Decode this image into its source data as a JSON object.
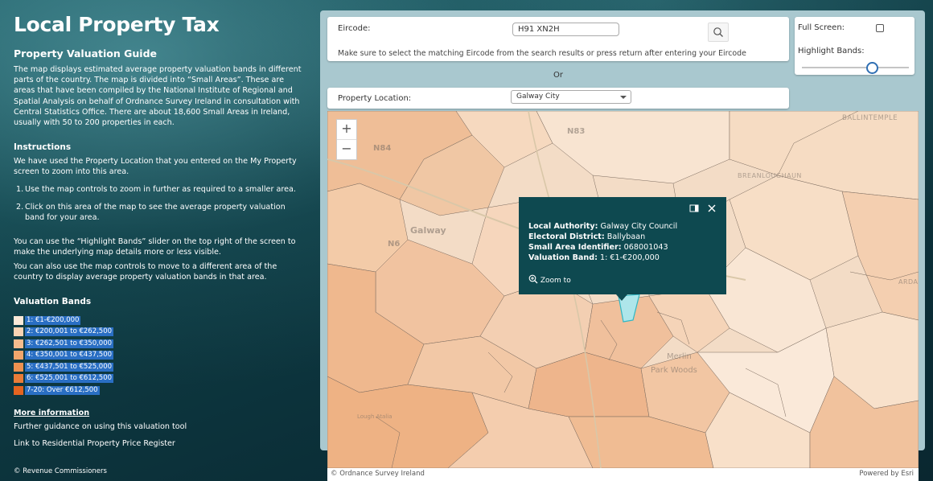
{
  "sidebar": {
    "title": "Local Property Tax",
    "subtitle": "Property Valuation Guide",
    "intro": "The map displays estimated average property valuation bands in different parts of the country. The map is divided into “Small Areas”. These are areas that have been compiled by the National Institute of Regional and Spatial Analysis on behalf of Ordnance Survey Ireland in consultation with Central Statistics Office. There are about 18,600 Small Areas in Ireland, usually with 50 to 200 properties in each.",
    "instructions_heading": "Instructions",
    "instructions_intro": "We have used the Property Location that you entered on the My Property screen to zoom into this area.",
    "steps": [
      {
        "num": "1.",
        "text": "Use the map controls to zoom in further as required to a smaller area."
      },
      {
        "num": "2.",
        "text": "Click on this area of the map to see the average property valuation band for your area."
      }
    ],
    "highlight_note": "You can use the “Highlight Bands” slider on the top right of the screen to make the underlying map details more or less visible.",
    "controls_note": "You can also use the map controls to move to a different area of the country to display average property valuation bands in that area.",
    "bands_heading": "Valuation Bands",
    "bands": [
      {
        "label": "1: €1-€200,000",
        "color": "#fbe9d8"
      },
      {
        "label": "2: €200,001 to €262,500",
        "color": "#f8d3b3"
      },
      {
        "label": "3: €262,501 to €350,000",
        "color": "#f5bc8e"
      },
      {
        "label": "4: €350,001 to €437,500",
        "color": "#f1a66c"
      },
      {
        "label": "5: €437,501 to €525,000",
        "color": "#ee9150"
      },
      {
        "label": "6: €525,001 to €612,500",
        "color": "#ea7c38"
      },
      {
        "label": "7-20: Over €612,500",
        "color": "#e46420"
      }
    ],
    "more_info": "More information",
    "guidance_link": "Further guidance on using this valuation tool",
    "register_link": "Link to Residential Property Price Register",
    "copyright": "© Revenue Commissioners"
  },
  "search": {
    "eircode_label": "Eircode:",
    "eircode_value": "H91 XN2H",
    "hint": "Make sure to select the matching Eircode from the search results or press return after entering your Eircode",
    "or": "Or",
    "location_label": "Property Location:",
    "location_value": "Galway City"
  },
  "options": {
    "fullscreen_label": "Full Screen:",
    "highlight_label": "Highlight Bands:",
    "highlight_value": 0.65
  },
  "map": {
    "zoom_in": "+",
    "zoom_out": "−",
    "labels": {
      "ballintemple": "BALLINTEMPLE",
      "breanloughaun": "BREANLOUGHAUN",
      "galway": "Galway",
      "n84": "N84",
      "n83": "N83",
      "n6": "N6",
      "arda": "ARDA",
      "merlin": "Merlin",
      "park_woods": "Park Woods",
      "lough_atalia": "Lough Atalia"
    },
    "attribution": "© Ordnance Survey Ireland",
    "powered_by": "Powered by Esri"
  },
  "popup": {
    "authority_label": "Local Authority:",
    "authority_value": "Galway City Council",
    "district_label": "Electoral District:",
    "district_value": "Ballybaan",
    "area_label": "Small Area Identifier:",
    "area_value": "068001043",
    "band_label": "Valuation Band:",
    "band_value": "1: €1-€200,000",
    "zoom_to": "Zoom to"
  }
}
